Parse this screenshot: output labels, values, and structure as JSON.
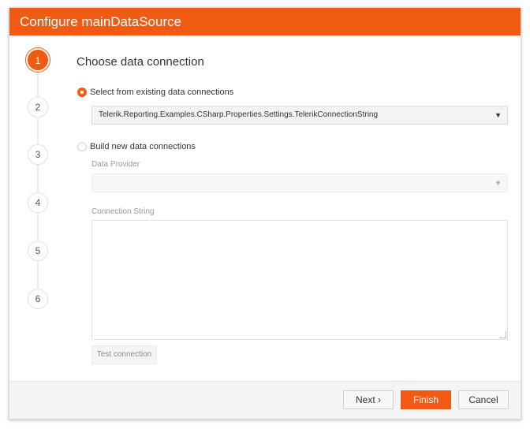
{
  "dialog": {
    "title": "Configure mainDataSource"
  },
  "steps": [
    {
      "label": "1",
      "active": true
    },
    {
      "label": "2",
      "active": false
    },
    {
      "label": "3",
      "active": false
    },
    {
      "label": "4",
      "active": false
    },
    {
      "label": "5",
      "active": false
    },
    {
      "label": "6",
      "active": false
    }
  ],
  "content": {
    "heading": "Choose data connection",
    "existing_option_label": "Select from existing data connections",
    "existing_connection_value": "Telerik.Reporting.Examples.CSharp.Properties.Settings.TelerikConnectionString",
    "new_option_label": "Build new data connections",
    "data_provider_label": "Data Provider",
    "data_provider_value": "",
    "connection_string_label": "Connection String",
    "connection_string_value": "",
    "test_connection_label": "Test connection",
    "caret_glyph": "▼"
  },
  "footer": {
    "next_label": "Next ›",
    "finish_label": "Finish",
    "cancel_label": "Cancel"
  },
  "colors": {
    "accent": "#f05a12"
  }
}
